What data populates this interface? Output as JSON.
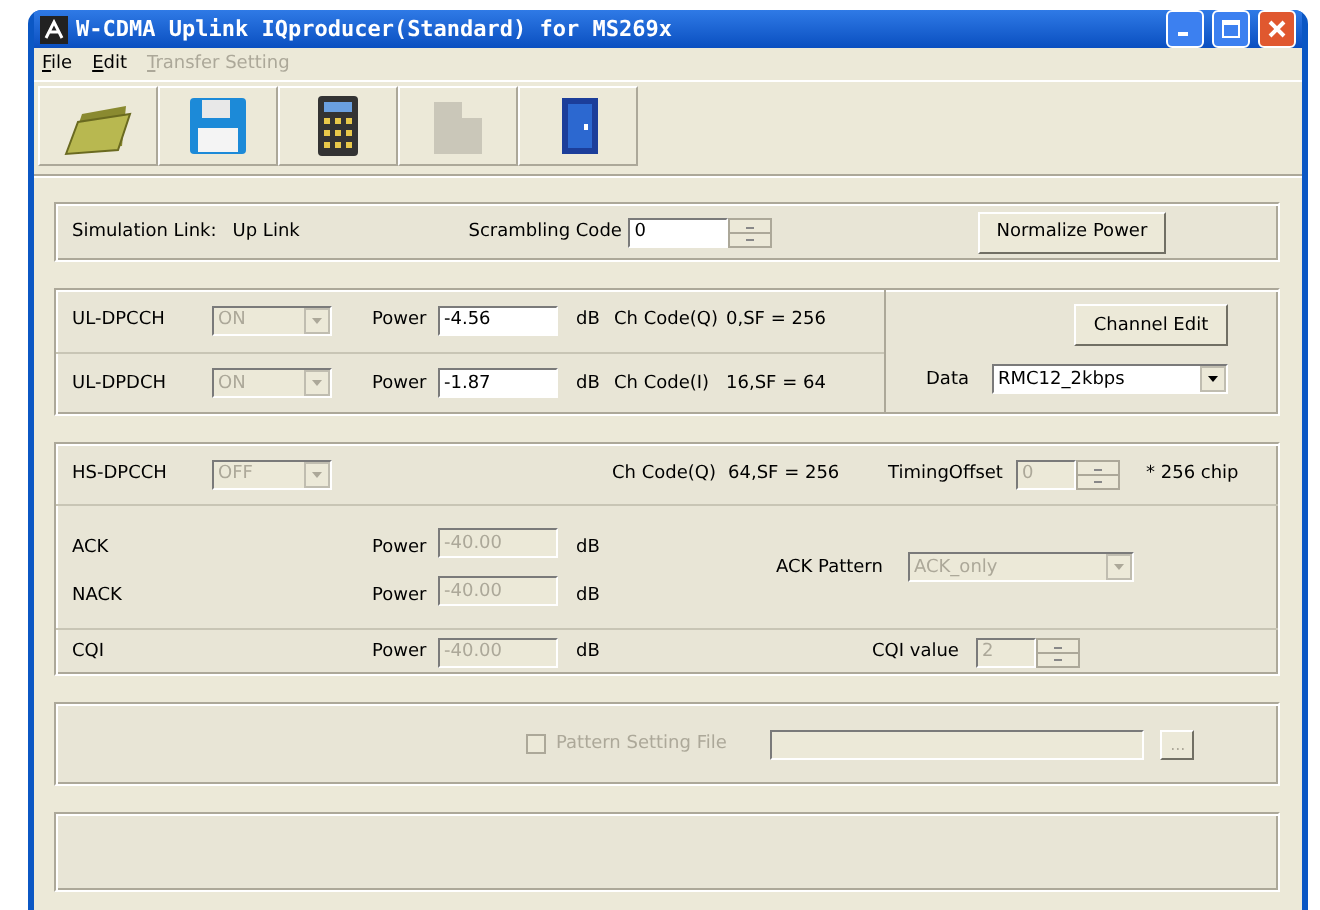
{
  "window": {
    "title": "W-CDMA Uplink IQproducer(Standard) for MS269x"
  },
  "menu": [
    {
      "label": "File",
      "disabled": false
    },
    {
      "label": "Edit",
      "disabled": false
    },
    {
      "label": "Transfer Setting",
      "disabled": true
    }
  ],
  "toolbar": [
    {
      "kind": "open",
      "disabled": false
    },
    {
      "kind": "save",
      "disabled": false
    },
    {
      "kind": "calculator",
      "disabled": false
    },
    {
      "kind": "transfer",
      "disabled": true
    },
    {
      "kind": "exit",
      "disabled": false
    }
  ],
  "simulation": {
    "link_label": "Simulation Link:",
    "link_value": "Up Link",
    "scrambling_label": "Scrambling Code",
    "scrambling_value": "0",
    "normalize_button": "Normalize Power"
  },
  "channels": [
    {
      "name": "UL-DPCCH",
      "state": "ON",
      "state_disabled": true,
      "power_label": "Power",
      "power": "-4.56",
      "unit": "dB",
      "ch_code_label": "Ch Code(Q)",
      "ch_code": "0,SF = 256"
    },
    {
      "name": "UL-DPDCH",
      "state": "ON",
      "state_disabled": true,
      "power_label": "Power",
      "power": "-1.87",
      "unit": "dB",
      "ch_code_label": "Ch Code(I)",
      "ch_code": "16,SF = 64"
    }
  ],
  "channel_edit_button": "Channel Edit",
  "data": {
    "label": "Data",
    "value": "RMC12_2kbps"
  },
  "hs_dpcch": {
    "name": "HS-DPCCH",
    "state": "OFF",
    "state_disabled": true,
    "ch_code_label": "Ch Code(Q)",
    "ch_code": "64,SF = 256",
    "timing_label": "TimingOffset",
    "timing_value": "0",
    "timing_disabled": true,
    "timing_unit": "* 256 chip"
  },
  "hs_fields": [
    {
      "name": "ACK",
      "power_label": "Power",
      "power": "-40.00",
      "unit": "dB",
      "disabled": true
    },
    {
      "name": "NACK",
      "power_label": "Power",
      "power": "-40.00",
      "unit": "dB",
      "disabled": true
    }
  ],
  "ack_pattern": {
    "label": "ACK Pattern",
    "value": "ACK_only",
    "disabled": true
  },
  "cqi": {
    "name": "CQI",
    "power_label": "Power",
    "power": "-40.00",
    "unit": "dB",
    "disabled": true,
    "value_label": "CQI value",
    "value": "2"
  },
  "pattern_file": {
    "label": "Pattern Setting File",
    "checked": false,
    "disabled": true,
    "browse": "..."
  }
}
